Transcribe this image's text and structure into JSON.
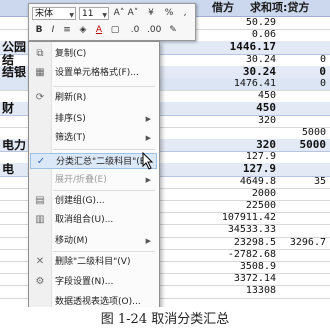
{
  "header": {
    "col1": "借方",
    "col2": "求和项:贷方"
  },
  "rows": [
    {
      "left": "",
      "v1": "50.29",
      "v2": "",
      "style": ""
    },
    {
      "left": "",
      "v1": "0.06",
      "v2": "",
      "style": ""
    },
    {
      "left": "公园",
      "v1": "1446.17",
      "v2": "",
      "style": "bold"
    },
    {
      "left": "结",
      "v1": "30.24",
      "v2": "0",
      "style": ""
    },
    {
      "left": "结银",
      "v1": "30.24",
      "v2": "0",
      "style": "bold"
    },
    {
      "left": "",
      "v1": "1476.41",
      "v2": "0",
      "style": "band"
    },
    {
      "left": "",
      "v1": "450",
      "v2": "",
      "style": ""
    },
    {
      "left": "财",
      "v1": "450",
      "v2": "",
      "style": "bold"
    },
    {
      "left": "",
      "v1": "320",
      "v2": "",
      "style": ""
    },
    {
      "left": "",
      "v1": "",
      "v2": "5000",
      "style": ""
    },
    {
      "left": "电力",
      "v1": "320",
      "v2": "5000",
      "style": "bold"
    },
    {
      "left": "",
      "v1": "127.9",
      "v2": "",
      "style": ""
    },
    {
      "left": "电",
      "v1": "127.9",
      "v2": "",
      "style": "bold"
    },
    {
      "left": "",
      "v1": "4649.8",
      "v2": "35",
      "style": ""
    },
    {
      "left": "",
      "v1": "2000",
      "v2": "",
      "style": ""
    },
    {
      "left": "",
      "v1": "22500",
      "v2": "",
      "style": ""
    },
    {
      "left": "",
      "v1": "107911.42",
      "v2": "",
      "style": ""
    },
    {
      "left": "",
      "v1": "34533.33",
      "v2": "",
      "style": ""
    },
    {
      "left": "",
      "v1": "23298.5",
      "v2": "3296.7",
      "style": ""
    },
    {
      "left": "",
      "v1": "-2782.68",
      "v2": "",
      "style": ""
    },
    {
      "left": "",
      "v1": "3508.9",
      "v2": "",
      "style": ""
    },
    {
      "left": "",
      "v1": "3372.14",
      "v2": "",
      "style": ""
    },
    {
      "left": "",
      "v1": "13308",
      "v2": "",
      "style": ""
    }
  ],
  "mini_toolbar": {
    "font_name": "宋体",
    "font_size": "11",
    "grow_font": "A˄",
    "shrink_font": "A˅",
    "currency": "¥",
    "percent": "%",
    "bold": "B",
    "italic": "I",
    "font_color": "A"
  },
  "context_menu": [
    {
      "label": "复制(C)",
      "icon": "copy-icon",
      "glyph": "⧉",
      "submenu": false,
      "disabled": false
    },
    {
      "label": "设置单元格格式(F)...",
      "icon": "format-cells-icon",
      "glyph": "▦",
      "submenu": false,
      "disabled": false
    },
    {
      "label": "刷新(R)",
      "icon": "refresh-icon",
      "glyph": "⟳",
      "submenu": false,
      "disabled": false
    },
    {
      "label": "排序(S)",
      "icon": "sort-icon",
      "glyph": "",
      "submenu": true,
      "disabled": false
    },
    {
      "label": "筛选(T)",
      "icon": "filter-icon",
      "glyph": "",
      "submenu": true,
      "disabled": false
    },
    {
      "label": "分类汇总\"二级科目\"(B)",
      "icon": "check-icon",
      "glyph": "✓",
      "submenu": false,
      "disabled": false
    },
    {
      "label": "展开/折叠(E)",
      "icon": "expand-icon",
      "glyph": "",
      "submenu": true,
      "disabled": true
    },
    {
      "label": "创建组(G)...",
      "icon": "group-icon",
      "glyph": "▤",
      "submenu": false,
      "disabled": false
    },
    {
      "label": "取消组合(U)...",
      "icon": "ungroup-icon",
      "glyph": "▥",
      "submenu": false,
      "disabled": false
    },
    {
      "label": "移动(M)",
      "icon": "move-icon",
      "glyph": "",
      "submenu": true,
      "disabled": false
    },
    {
      "label": "删除\"二级科目\"(V)",
      "icon": "delete-icon",
      "glyph": "✕",
      "submenu": false,
      "disabled": false
    },
    {
      "label": "字段设置(N)...",
      "icon": "field-settings-icon",
      "glyph": "⚙",
      "submenu": false,
      "disabled": false
    },
    {
      "label": "数据透视表选项(O)...",
      "icon": "pivot-options-icon",
      "glyph": "",
      "submenu": false,
      "disabled": false
    },
    {
      "label": "隐藏字段列表(D)",
      "icon": "field-list-icon",
      "glyph": "▣",
      "submenu": false,
      "disabled": false
    }
  ],
  "caption": "图 1-24 取消分类汇总"
}
